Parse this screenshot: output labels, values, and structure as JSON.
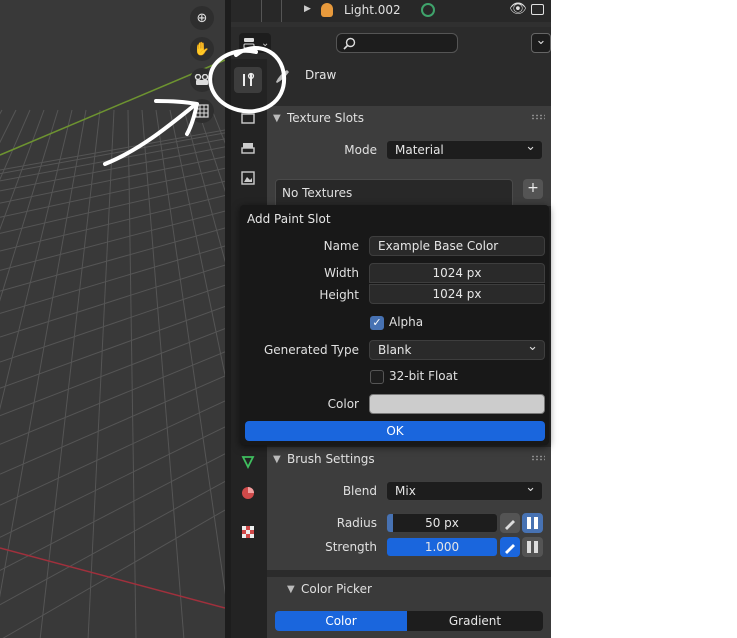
{
  "outliner": {
    "item_label": "Light.002"
  },
  "header": {
    "search_placeholder": ""
  },
  "tool": {
    "name": "Draw"
  },
  "texture_slots": {
    "title": "Texture Slots",
    "mode_label": "Mode",
    "mode_value": "Material",
    "list_empty": "No Textures",
    "add_glyph": "+"
  },
  "popup": {
    "title": "Add Paint Slot",
    "name_label": "Name",
    "name_value": "Example Base Color",
    "width_label": "Width",
    "width_value": "1024 px",
    "height_label": "Height",
    "height_value": "1024 px",
    "alpha_label": "Alpha",
    "alpha_checked": true,
    "gen_type_label": "Generated Type",
    "gen_type_value": "Blank",
    "float_label": "32-bit Float",
    "float_checked": false,
    "color_label": "Color",
    "color_value": "#cccccc",
    "ok_label": "OK"
  },
  "brush_settings": {
    "title": "Brush Settings",
    "blend_label": "Blend",
    "blend_value": "Mix",
    "radius_label": "Radius",
    "radius_value": "50 px",
    "radius_fraction": 0.05,
    "strength_label": "Strength",
    "strength_value": "1.000",
    "strength_fraction": 1.0
  },
  "color_picker": {
    "title": "Color Picker",
    "tab_color": "Color",
    "tab_gradient": "Gradient"
  },
  "colors": {
    "accent": "#4772b3",
    "ok_button": "#1a66dd",
    "viewport_bg": "#393939",
    "grid_line": "#555555",
    "x_axis": "#a0303c",
    "y_axis": "#6d9330",
    "annotation": "#ffffff"
  },
  "icons": {
    "zoom": "zoom-icon",
    "hand": "hand-pan-icon",
    "camera": "camera-icon",
    "grid": "grid-icon",
    "tool_tab": "tool-wrench-icon",
    "eye": "eye-icon",
    "search": "search-icon",
    "brush": "brush-icon"
  }
}
